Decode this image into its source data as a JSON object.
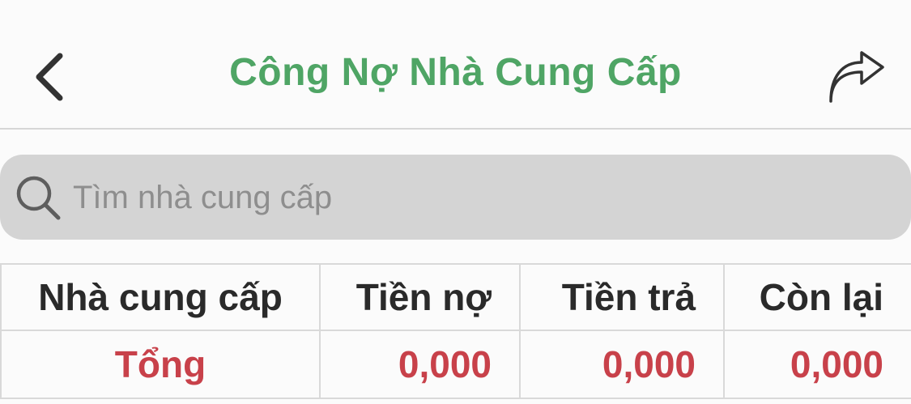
{
  "header": {
    "title": "Công Nợ Nhà Cung Cấp",
    "back_icon": "chevron-left-icon",
    "share_icon": "share-arrow-icon",
    "title_color": "#4fa565"
  },
  "search": {
    "placeholder": "Tìm nhà cung cấp",
    "value": "",
    "icon": "search-icon"
  },
  "table": {
    "columns": [
      "Nhà cung cấp",
      "Tiền nợ",
      "Tiền trả",
      "Còn lại"
    ],
    "total_row": {
      "label": "Tổng",
      "tien_no": "0,000",
      "tien_tra": "0,000",
      "con_lai": "0,000"
    },
    "total_color": "#c8414a"
  }
}
